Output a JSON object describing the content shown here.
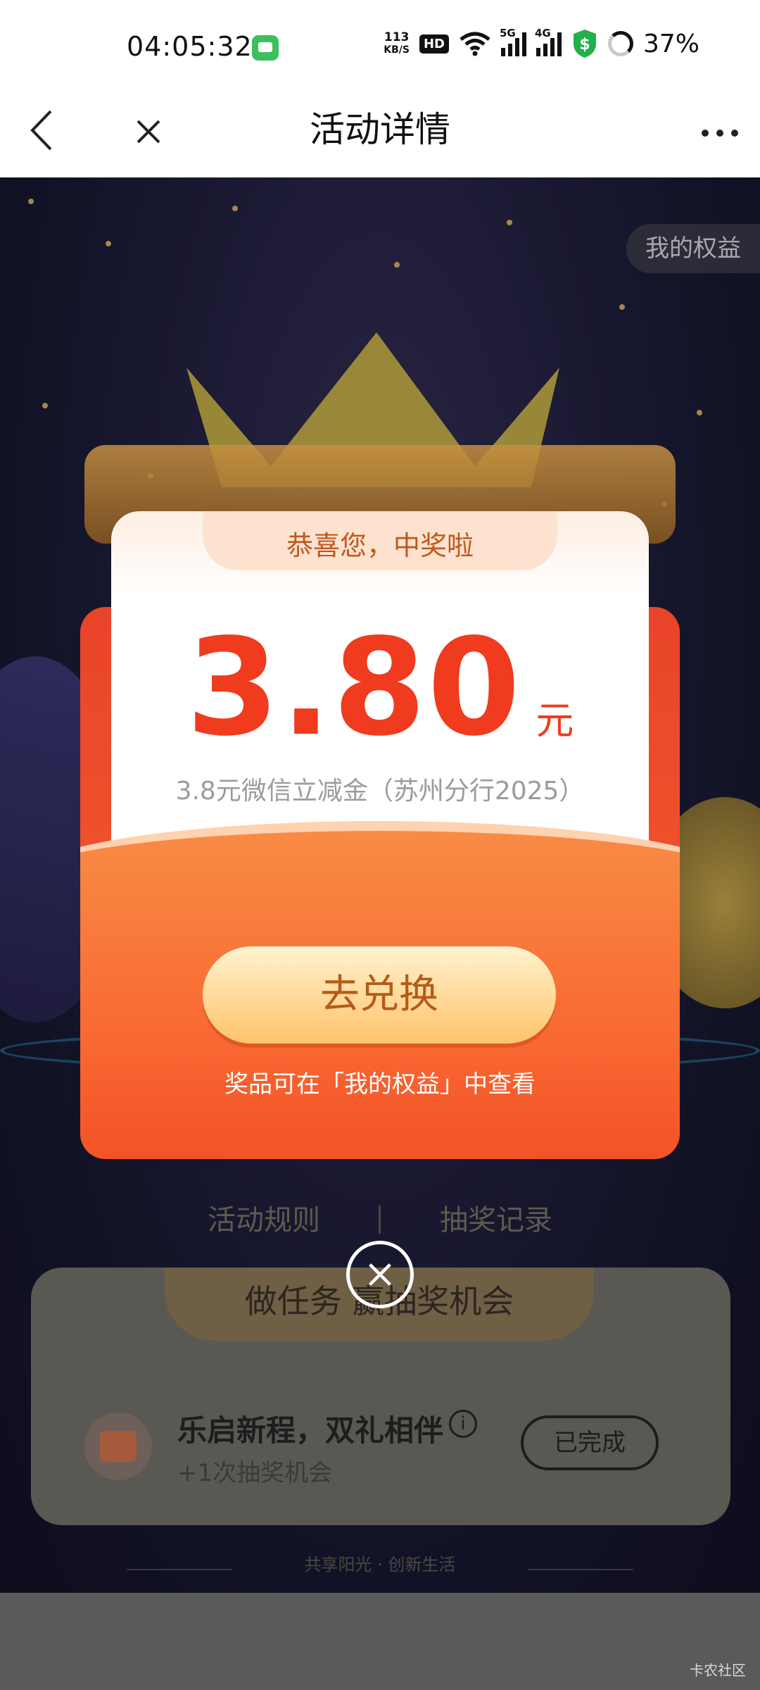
{
  "status_bar": {
    "time": "04:05:32",
    "network_speed": "113",
    "network_speed_unit": "KB/S",
    "hd_label": "HD",
    "signal_5g": "5G",
    "signal_4g": "4G",
    "battery": "37%"
  },
  "nav": {
    "title": "活动详情"
  },
  "background": {
    "my_rights": "我的权益",
    "rules_link": "活动规则",
    "records_link": "抽奖记录",
    "task_section_title": "做任务 赢抽奖机会",
    "task": {
      "name": "乐启新程，双礼相伴",
      "info": "i",
      "reward": "+1次抽奖机会",
      "status": "已完成"
    },
    "slogan": "共享阳光 · 创新生活"
  },
  "modal": {
    "congrats": "恭喜您，中奖啦",
    "amount": "3.80",
    "unit": "元",
    "description": "3.8元微信立减金（苏州分行2025）",
    "redeem_button": "去兑换",
    "hint": "奖品可在「我的权益」中查看"
  },
  "watermark": "卡农社区",
  "colors": {
    "prize_red": "#f03b1e",
    "modal_orange": "#f96b34",
    "status_green": "#3cc05e"
  }
}
